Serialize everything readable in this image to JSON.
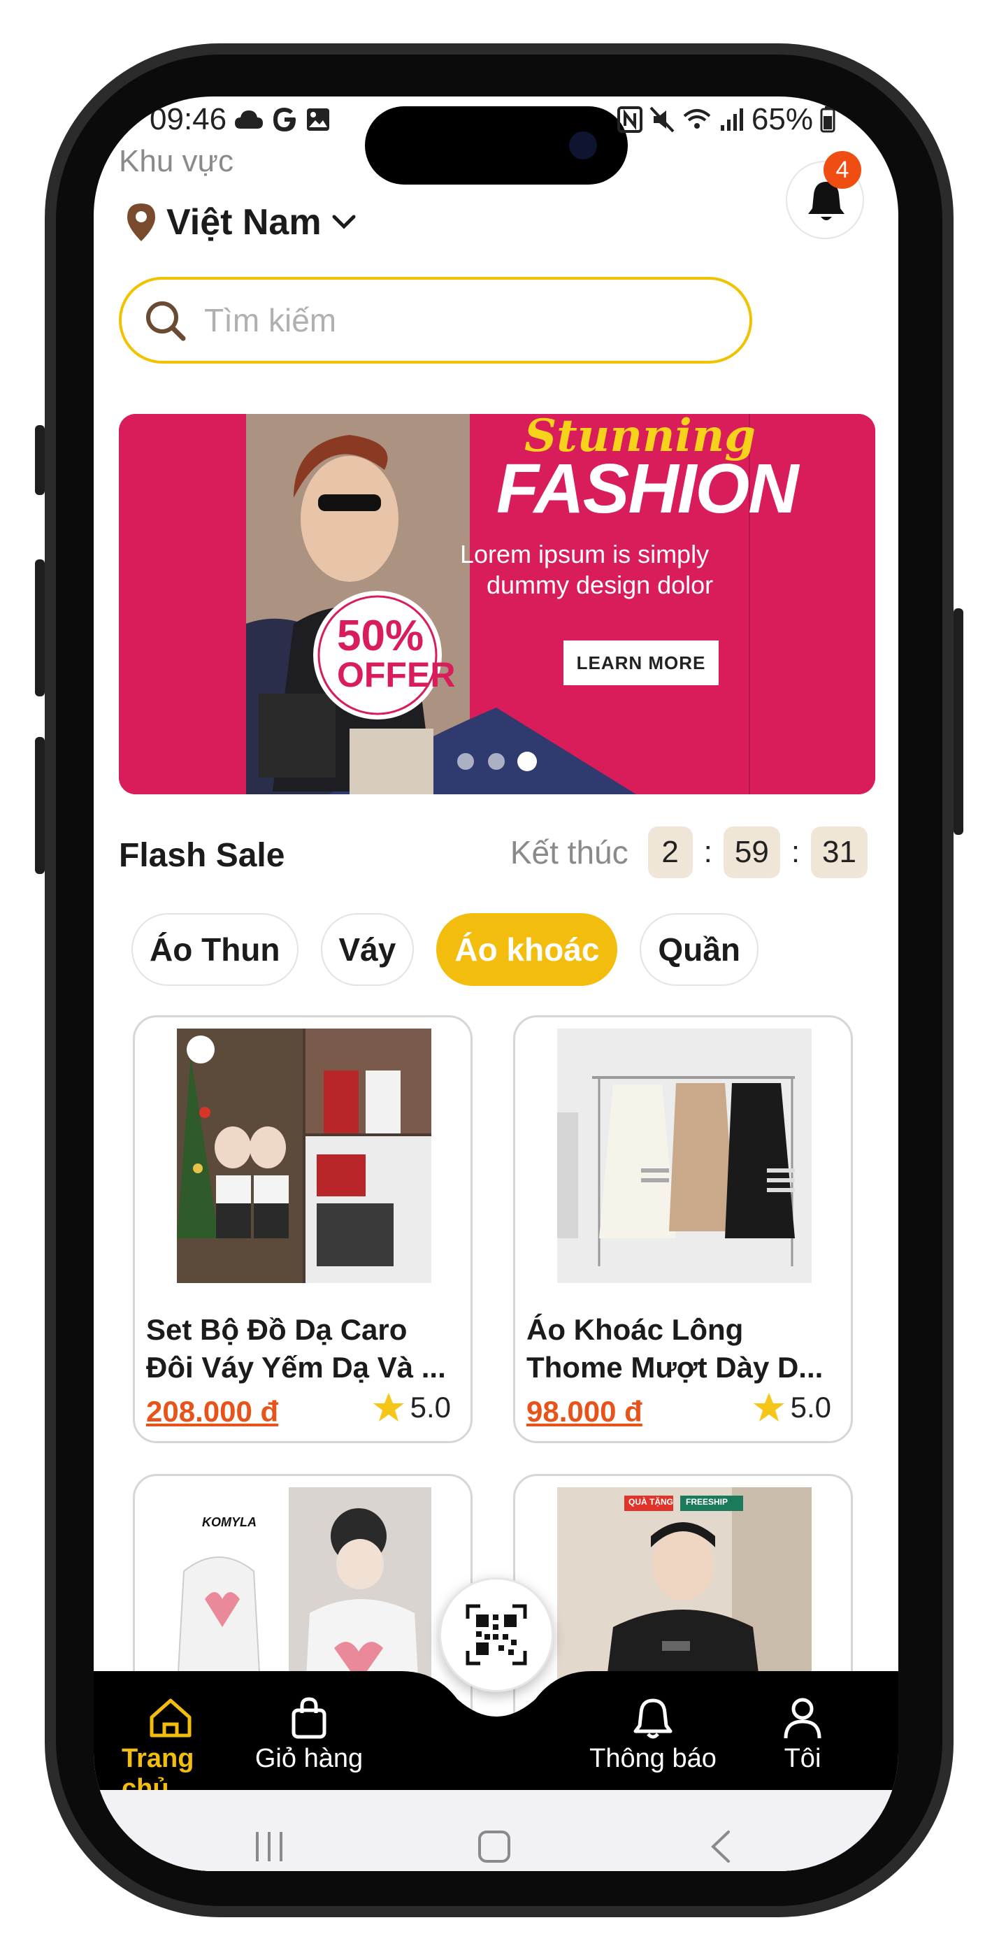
{
  "status_bar": {
    "time": "09:46",
    "battery": "65%"
  },
  "header": {
    "region_label": "Khu vực",
    "region_value": "Việt Nam",
    "notification_count": "4"
  },
  "search": {
    "placeholder": "Tìm kiếm"
  },
  "banner": {
    "script_title": "Stunning",
    "title": "FASHION",
    "subtitle_line1": "Lorem ipsum is simply",
    "subtitle_line2": "dummy design dolor",
    "offer_number": "50%",
    "offer_word": "OFFER",
    "cta": "LEARN MORE",
    "active_dot": 3,
    "dot_count": 3
  },
  "flash_sale": {
    "title": "Flash Sale",
    "ends_label": "Kết thúc",
    "hours": "2",
    "minutes": "59",
    "seconds": "31"
  },
  "categories": [
    {
      "label": "Áo Thun",
      "active": false
    },
    {
      "label": "Váy",
      "active": false
    },
    {
      "label": "Áo khoác",
      "active": true
    },
    {
      "label": "Quần",
      "active": false
    }
  ],
  "products": [
    {
      "name_line1": "Set Bộ Đồ Dạ Caro",
      "name_line2": "Đôi Váy Yếm Dạ Và ...",
      "price": "208.000 đ",
      "rating": "5.0"
    },
    {
      "name_line1": "Áo Khoác Lông",
      "name_line2": "Thome Mượt Dày D...",
      "price": "98.000 đ",
      "rating": "5.0"
    },
    {
      "brand_text": "KOMYLA"
    },
    {
      "tag_gift": "QUÀ TẶNG",
      "tag_ship": "FREESHIP"
    }
  ],
  "bottom_nav": {
    "home": "Trang chủ",
    "cart": "Giỏ hàng",
    "notifications": "Thông báo",
    "profile": "Tôi"
  },
  "colors": {
    "accent": "#f2bd0c",
    "price": "#e8531a",
    "banner": "#d81d5a",
    "badge": "#ef4d11",
    "nav_bg": "#000000"
  }
}
